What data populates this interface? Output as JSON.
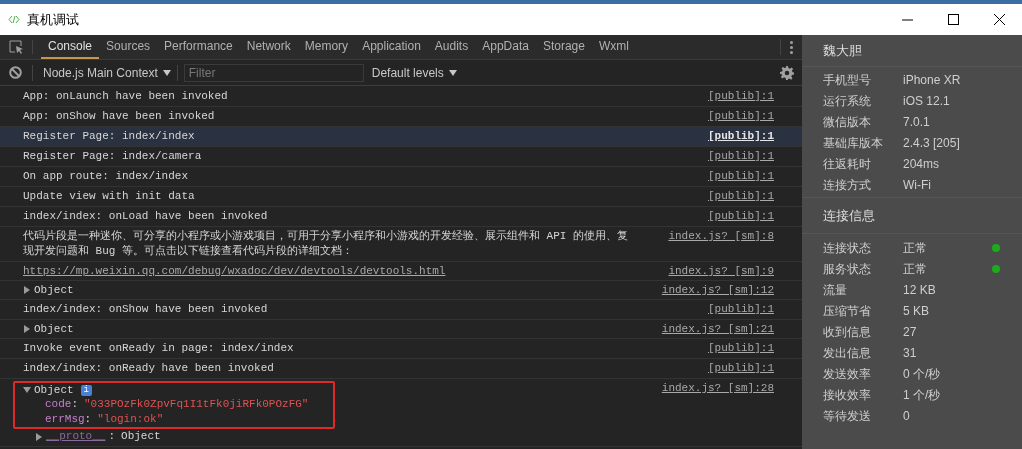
{
  "window": {
    "title": "真机调试"
  },
  "tabs": [
    {
      "label": "Console",
      "selected": true
    },
    {
      "label": "Sources",
      "selected": false
    },
    {
      "label": "Performance",
      "selected": false
    },
    {
      "label": "Network",
      "selected": false
    },
    {
      "label": "Memory",
      "selected": false
    },
    {
      "label": "Application",
      "selected": false
    },
    {
      "label": "Audits",
      "selected": false
    },
    {
      "label": "AppData",
      "selected": false
    },
    {
      "label": "Storage",
      "selected": false
    },
    {
      "label": "Wxml",
      "selected": false
    }
  ],
  "toolbar": {
    "context": "Node.js Main Context",
    "filter": {
      "placeholder": "Filter"
    },
    "levels": "Default levels"
  },
  "console": [
    {
      "kind": "text",
      "text": "App: onLaunch have been invoked",
      "source": "[publib]:1",
      "selected": false
    },
    {
      "kind": "text",
      "text": "App: onShow have been invoked",
      "source": "[publib]:1",
      "selected": false
    },
    {
      "kind": "text",
      "text": "Register Page: index/index",
      "source": "[publib]:1",
      "selected": true
    },
    {
      "kind": "text",
      "text": "Register Page: index/camera",
      "source": "[publib]:1",
      "selected": false
    },
    {
      "kind": "text",
      "text": "On app route: index/index",
      "source": "[publib]:1",
      "selected": false
    },
    {
      "kind": "text",
      "text": "Update view with init data",
      "source": "[publib]:1",
      "selected": false
    },
    {
      "kind": "text",
      "text": "index/index: onLoad have been invoked",
      "source": "[publib]:1",
      "selected": false
    },
    {
      "kind": "text",
      "text": "代码片段是一种迷你、可分享的小程序或小游戏项目，可用于分享小程序和小游戏的开发经验、展示组件和 API 的使用、复现开发问题和 Bug 等。可点击以下链接查看代码片段的详细文档：",
      "source": "index.js? [sm]:8",
      "selected": false
    },
    {
      "kind": "link",
      "text": "https://mp.weixin.qq.com/debug/wxadoc/dev/devtools/devtools.html",
      "source": "index.js? [sm]:9",
      "selected": false
    },
    {
      "kind": "object",
      "text": "Object",
      "source": "index.js? [sm]:12",
      "selected": false,
      "expanded": false
    },
    {
      "kind": "text",
      "text": "index/index: onShow have been invoked",
      "source": "[publib]:1",
      "selected": false
    },
    {
      "kind": "object",
      "text": "Object",
      "source": "index.js? [sm]:21",
      "selected": false,
      "expanded": false
    },
    {
      "kind": "text",
      "text": "Invoke event onReady in page: index/index",
      "source": "[publib]:1",
      "selected": false
    },
    {
      "kind": "text",
      "text": "index/index: onReady have been invoked",
      "source": "[publib]:1",
      "selected": false
    },
    {
      "kind": "object",
      "text": "Object",
      "source": "index.js? [sm]:28",
      "selected": false,
      "expanded": true,
      "badge": "i",
      "properties": [
        {
          "key": "code",
          "separator": ":",
          "value": "\"033POzFk0ZpvFq1I1tFk0jiRFk0POzFG\"",
          "kind": "string"
        },
        {
          "key": "errMsg",
          "separator": ":",
          "value": "\"login:ok\"",
          "kind": "string"
        },
        {
          "key": "__proto__",
          "separator": ":",
          "value": "Object",
          "kind": "object"
        }
      ]
    }
  ],
  "sidebar": {
    "title": "魏大胆",
    "device": [
      {
        "label": "手机型号",
        "value": "iPhone XR"
      },
      {
        "label": "运行系统",
        "value": "iOS 12.1"
      },
      {
        "label": "微信版本",
        "value": "7.0.1"
      },
      {
        "label": "基础库版本",
        "value": "2.4.3 [205]"
      },
      {
        "label": "往返耗时",
        "value": "204ms"
      },
      {
        "label": "连接方式",
        "value": "Wi-Fi"
      }
    ],
    "section": "连接信息",
    "connection": [
      {
        "label": "连接状态",
        "value": "正常",
        "color": "#1aad19"
      },
      {
        "label": "服务状态",
        "value": "正常",
        "color": "#1aad19"
      },
      {
        "label": "流量",
        "value": "12 KB"
      },
      {
        "label": "压缩节省",
        "value": "5 KB"
      },
      {
        "label": "收到信息",
        "value": "27"
      },
      {
        "label": "发出信息",
        "value": "31"
      },
      {
        "label": "发送效率",
        "value": "0 个/秒"
      },
      {
        "label": "接收效率",
        "value": "1 个/秒"
      },
      {
        "label": "等待发送",
        "value": "0"
      }
    ]
  }
}
